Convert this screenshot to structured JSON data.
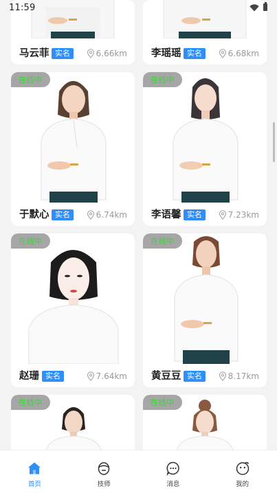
{
  "status_bar": {
    "time": "11:59"
  },
  "badges": {
    "online": "在线中",
    "verified": "实名"
  },
  "cards": [
    {
      "name": "马云菲",
      "distance": "6.66km",
      "online": false
    },
    {
      "name": "李瑶瑶",
      "distance": "6.68km",
      "online": false
    },
    {
      "name": "于默心",
      "distance": "6.74km",
      "online": true
    },
    {
      "name": "李语馨",
      "distance": "7.23km",
      "online": true
    },
    {
      "name": "赵珊",
      "distance": "7.64km",
      "online": true
    },
    {
      "name": "黄豆豆",
      "distance": "8.17km",
      "online": true
    },
    {
      "name": "",
      "distance": "",
      "online": true
    },
    {
      "name": "",
      "distance": "",
      "online": true
    }
  ],
  "bottom_nav": {
    "items": [
      {
        "label": "首页",
        "icon": "home-icon",
        "active": true
      },
      {
        "label": "技师",
        "icon": "technician-icon",
        "active": false
      },
      {
        "label": "消息",
        "icon": "message-icon",
        "active": false
      },
      {
        "label": "我的",
        "icon": "profile-icon",
        "active": false
      }
    ]
  },
  "colors": {
    "accent": "#2f8ff6",
    "online_text": "#3cd53c",
    "badge_bg": "#a6a6a6"
  }
}
